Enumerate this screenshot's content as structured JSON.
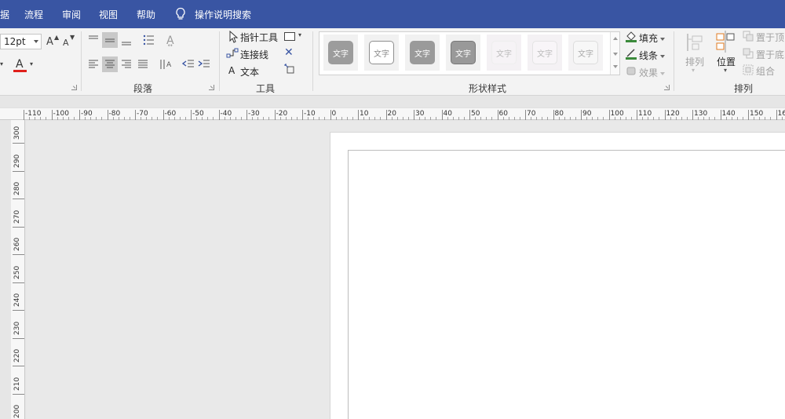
{
  "menubar": {
    "items": [
      "据",
      "流程",
      "审阅",
      "视图",
      "帮助"
    ],
    "search_label": "操作说明搜索"
  },
  "ribbon": {
    "font": {
      "size_value": "12pt",
      "grow_icon": "A",
      "shrink_icon": "A",
      "color_icon": "A"
    },
    "paragraph": {
      "label": "段落"
    },
    "tools": {
      "label": "工具",
      "pointer": "指针工具",
      "connector": "连接线",
      "text": "文本",
      "text_icon": "A"
    },
    "shape_styles": {
      "label": "形状样式",
      "swatch_text": "文字",
      "fill": "填充",
      "line": "线条",
      "effect": "效果"
    },
    "arrange": {
      "label": "排列",
      "arrange_btn": "排列",
      "position_btn": "位置",
      "bring_front": "置于顶",
      "send_back": "置于底",
      "group": "组合"
    }
  },
  "rulers": {
    "horizontal": [
      "-110",
      "-100",
      "-90",
      "-80",
      "-70",
      "-60",
      "-50",
      "-40",
      "-30",
      "-20",
      "-10",
      "0",
      "10",
      "20",
      "30",
      "40",
      "50",
      "60",
      "70",
      "80",
      "90",
      "100",
      "110",
      "120",
      "130",
      "140",
      "150",
      "16"
    ],
    "vertical": [
      "300",
      "290",
      "280",
      "270",
      "260",
      "250",
      "240",
      "230",
      "220",
      "210",
      "200"
    ]
  },
  "colors": {
    "menubar": "#3955a3",
    "font_color_red": "#e0201b",
    "fill_green": "#3a8a3a"
  }
}
